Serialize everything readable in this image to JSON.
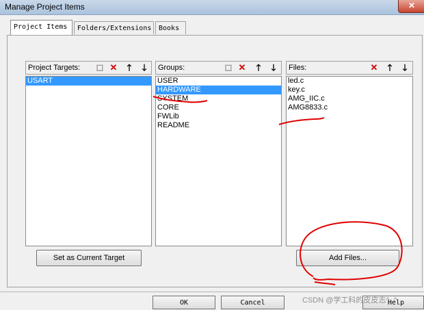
{
  "window": {
    "title": "Manage Project Items",
    "close_glyph": "✕"
  },
  "tabs": [
    {
      "label": "Project Items",
      "active": true
    },
    {
      "label": "Folders/Extensions",
      "active": false
    },
    {
      "label": "Books",
      "active": false
    }
  ],
  "targets_pane": {
    "label": "Project Targets:",
    "items": [
      {
        "label": "USART",
        "selected": true
      }
    ]
  },
  "groups_pane": {
    "label": "Groups:",
    "items": [
      {
        "label": "USER",
        "selected": false
      },
      {
        "label": "HARDWARE",
        "selected": true
      },
      {
        "label": "SYSTEM",
        "selected": false
      },
      {
        "label": "CORE",
        "selected": false
      },
      {
        "label": "FWLib",
        "selected": false
      },
      {
        "label": "README",
        "selected": false
      }
    ]
  },
  "files_pane": {
    "label": "Files:",
    "items": [
      {
        "label": "led.c"
      },
      {
        "label": "key.c"
      },
      {
        "label": "AMG_IIC.c"
      },
      {
        "label": "AMG8833.c"
      }
    ]
  },
  "toolbar_icons": {
    "new": "⬚",
    "delete": "✕",
    "up": "🡑",
    "down": "🡓"
  },
  "buttons": {
    "set_current_target": "Set as Current Target",
    "add_files": "Add Files...",
    "ok": "OK",
    "cancel": "Cancel",
    "help": "Help"
  },
  "annotation_color": "#e00000",
  "watermark": "CSDN @学工科的皮皮志^_^"
}
